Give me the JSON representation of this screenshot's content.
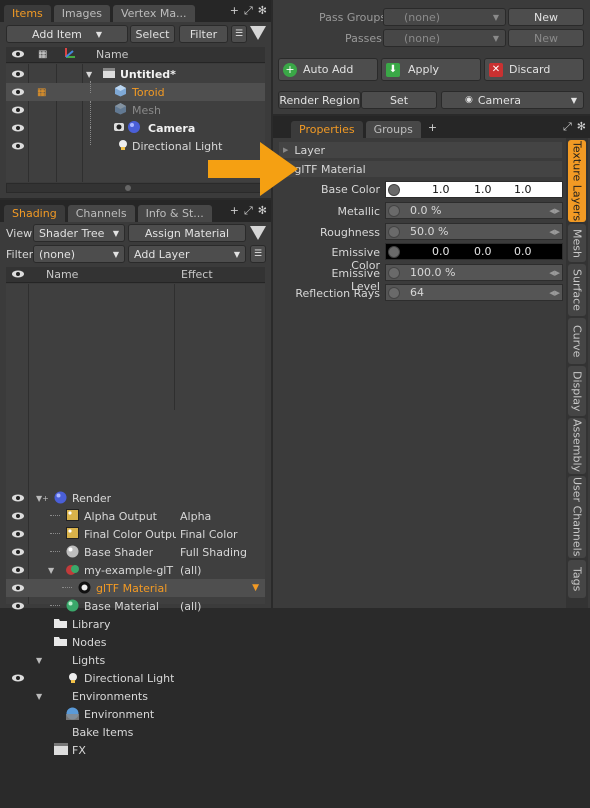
{
  "items_panel": {
    "tabs": [
      {
        "label": "Items"
      },
      {
        "label": "Images"
      },
      {
        "label": "Vertex Ma..."
      }
    ],
    "add_item_label": "Add Item",
    "select_label": "Select",
    "filter_label": "Filter",
    "column_name": "Name",
    "rows": [
      {
        "label": "Untitled*",
        "icon": "scene-icon"
      },
      {
        "label": "Toroid",
        "icon": "mesh-icon"
      },
      {
        "label": "Mesh",
        "icon": "mesh-icon"
      },
      {
        "label": "Camera",
        "icon": "camera-icon"
      },
      {
        "label": "Directional Light",
        "icon": "light-icon"
      }
    ]
  },
  "shading_panel": {
    "tabs": [
      {
        "label": "Shading"
      },
      {
        "label": "Channels"
      },
      {
        "label": "Info & St..."
      }
    ],
    "view_label": "View",
    "view_value": "Shader Tree",
    "assign_material_label": "Assign Material",
    "filter_label": "Filter",
    "filter_value": "(none)",
    "add_layer_label": "Add Layer",
    "col_name": "Name",
    "col_effect": "Effect",
    "rows": [
      {
        "label": "Render",
        "effect": ""
      },
      {
        "label": "Alpha Output",
        "effect": "Alpha"
      },
      {
        "label": "Final Color Output",
        "effect": "Final Color"
      },
      {
        "label": "Base Shader",
        "effect": "Full Shading"
      },
      {
        "label": "my-example-glT ...",
        "effect": "(all)"
      },
      {
        "label": "glTF Material",
        "effect": ""
      },
      {
        "label": "Base Material",
        "effect": "(all)"
      },
      {
        "label": "Library",
        "effect": ""
      },
      {
        "label": "Nodes",
        "effect": ""
      },
      {
        "label": "Lights",
        "effect": ""
      },
      {
        "label": "Directional Light",
        "effect": ""
      },
      {
        "label": "Environments",
        "effect": ""
      },
      {
        "label": "Environment",
        "effect": ""
      },
      {
        "label": "Bake Items",
        "effect": ""
      },
      {
        "label": "FX",
        "effect": ""
      }
    ]
  },
  "pass_panel": {
    "pass_groups_label": "Pass Groups",
    "pass_groups_value": "(none)",
    "passes_label": "Passes",
    "passes_value": "(none)",
    "new_label": "New",
    "auto_add_label": "Auto Add",
    "apply_label": "Apply",
    "discard_label": "Discard",
    "render_region_label": "Render Region",
    "set_label": "Set",
    "camera_value": "Camera"
  },
  "properties_panel": {
    "tabs": [
      {
        "label": "Properties"
      },
      {
        "label": "Groups"
      }
    ],
    "layer_section": "Layer",
    "material_section": "glTF Material",
    "base_color": {
      "label": "Base Color",
      "r": "1.0",
      "g": "1.0",
      "b": "1.0"
    },
    "metallic": {
      "label": "Metallic",
      "value": "0.0 %"
    },
    "roughness": {
      "label": "Roughness",
      "value": "50.0 %"
    },
    "emissive_color": {
      "label": "Emissive Color",
      "r": "0.0",
      "g": "0.0",
      "b": "0.0"
    },
    "emissive_level": {
      "label": "Emissive Level",
      "value": "100.0 %"
    },
    "reflection_rays": {
      "label": "Reflection Rays",
      "value": "64"
    },
    "side_tabs": [
      {
        "label": "Texture Layers"
      },
      {
        "label": "Mesh"
      },
      {
        "label": "Surface"
      },
      {
        "label": "Curve"
      },
      {
        "label": "Display"
      },
      {
        "label": "Assembly"
      },
      {
        "label": "User Channels"
      },
      {
        "label": "Tags"
      }
    ]
  },
  "colors": {
    "accent": "#f29a24",
    "selected_row": "#545454",
    "arrow": "#f5a012"
  }
}
